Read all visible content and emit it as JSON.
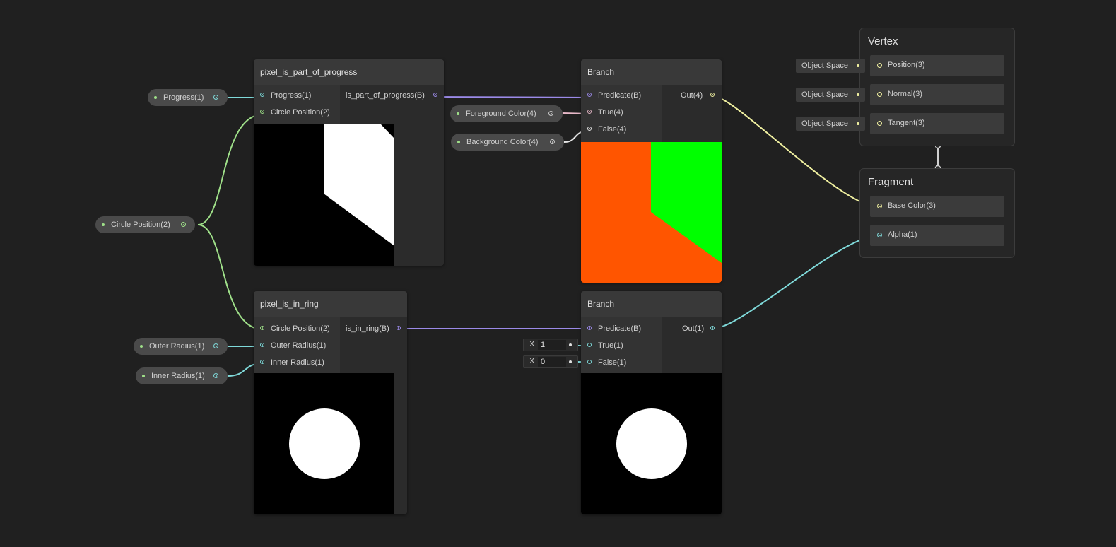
{
  "nodes": {
    "progress": {
      "title": "pixel_is_part_of_progress",
      "inputs": [
        "Progress(1)",
        "Circle Position(2)"
      ],
      "output": "is_part_of_progress(B)"
    },
    "ring": {
      "title": "pixel_is_in_ring",
      "inputs": [
        "Circle Position(2)",
        "Outer Radius(1)",
        "Inner Radius(1)"
      ],
      "output": "is_in_ring(B)"
    },
    "branch_color": {
      "title": "Branch",
      "inputs": [
        "Predicate(B)",
        "True(4)",
        "False(4)"
      ],
      "output": "Out(4)"
    },
    "branch_alpha": {
      "title": "Branch",
      "inputs": [
        "Predicate(B)",
        "True(1)",
        "False(1)"
      ],
      "output": "Out(1)",
      "true_value": "1",
      "false_value": "0",
      "axis_label": "X"
    }
  },
  "properties": {
    "progress": "Progress(1)",
    "circle_position": "Circle Position(2)",
    "outer_radius": "Outer Radius(1)",
    "inner_radius": "Inner Radius(1)",
    "foreground_color": "Foreground Color(4)",
    "background_color": "Background Color(4)"
  },
  "master": {
    "vertex": {
      "title": "Vertex",
      "rows": [
        "Position(3)",
        "Normal(3)",
        "Tangent(3)"
      ],
      "space": "Object Space"
    },
    "fragment": {
      "title": "Fragment",
      "rows": [
        "Base Color(3)",
        "Alpha(1)"
      ]
    }
  },
  "colors": {
    "background": "#202020",
    "foreground_preview": "#00ff00",
    "background_preview": "#ff5500",
    "wire_float": "#7fd9d9",
    "wire_vector2": "#9fe089",
    "wire_bool": "#9b8ae8",
    "wire_vector4": "#e7b8c8",
    "wire_vector3": "#f0f0a0"
  }
}
